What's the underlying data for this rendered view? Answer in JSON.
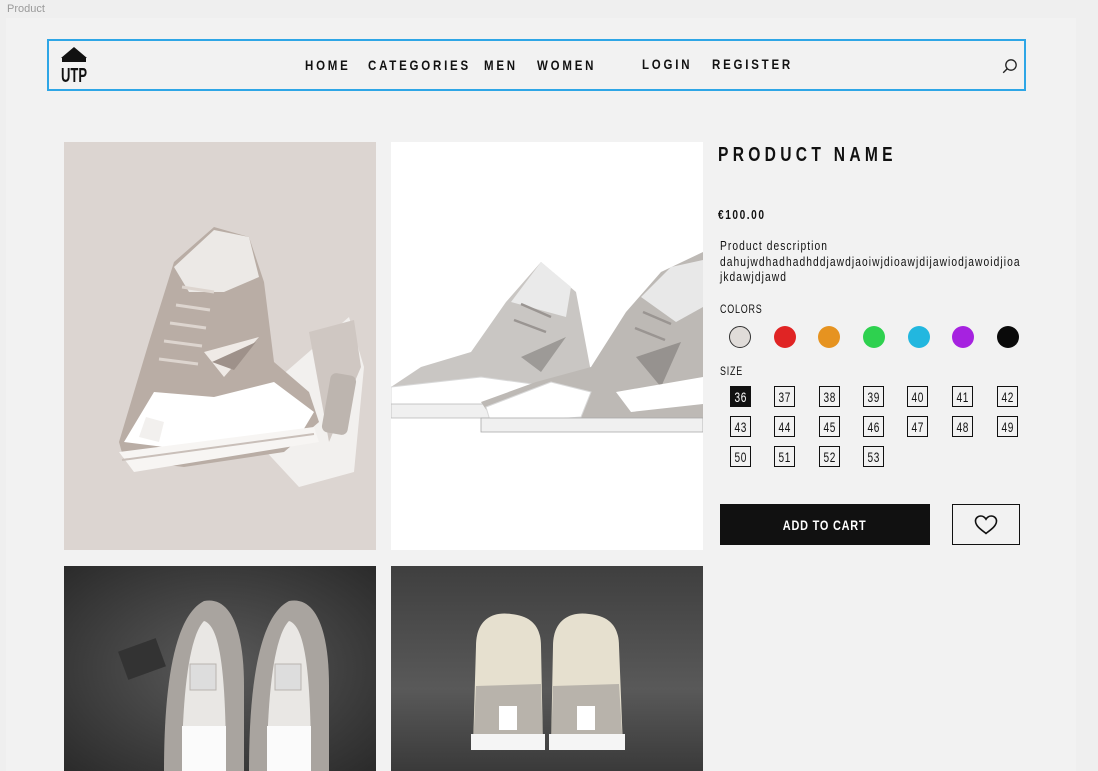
{
  "frame_label": "Product",
  "nav": {
    "logo_text": "UTP",
    "links": [
      "HOME",
      "CATEGORIES",
      "MEN",
      "WOMEN",
      "LOGIN",
      "REGISTER"
    ]
  },
  "product": {
    "name": "PRODUCT NAME",
    "price": "€100.00",
    "description_label": "Product description",
    "description_lines": [
      "dahujwdhadhadhddjawdjaoiwjdioawjdijawiodjawoidjioa",
      "jkdawjdjawd"
    ],
    "colors_label": "COLORS",
    "colors": [
      "#e0dcd9",
      "#e02424",
      "#e69320",
      "#2ed14f",
      "#22b7df",
      "#a622e0",
      "#0a0a0a"
    ],
    "size_label": "SIZE",
    "sizes": [
      "36",
      "37",
      "38",
      "39",
      "40",
      "41",
      "42",
      "43",
      "44",
      "45",
      "46",
      "47",
      "48",
      "49",
      "50",
      "51",
      "52",
      "53"
    ],
    "selected_size": "36",
    "add_to_cart": "ADD TO CART"
  },
  "icons": {
    "search": "search-icon",
    "wishlist": "heart-icon",
    "logo": "logo-icon"
  }
}
